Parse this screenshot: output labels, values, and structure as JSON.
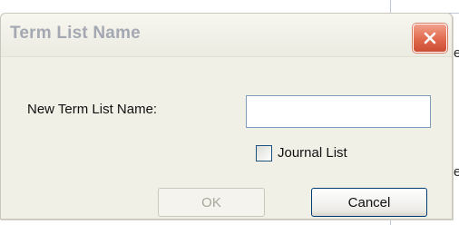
{
  "background": {
    "fragment_1": "e",
    "fragment_2": "e"
  },
  "dialog": {
    "title": "Term List Name",
    "field_label": "New Term List Name:",
    "field_value": "",
    "checkbox_label": "Journal List",
    "checkbox_checked": false,
    "ok_label": "OK",
    "cancel_label": "Cancel"
  },
  "icons": {
    "close": "close-icon"
  },
  "colors": {
    "title_text": "#a3a8b3",
    "close_button": "#e0694d",
    "dialog_bg": "#f1f0e6",
    "input_border": "#7f9db9"
  }
}
